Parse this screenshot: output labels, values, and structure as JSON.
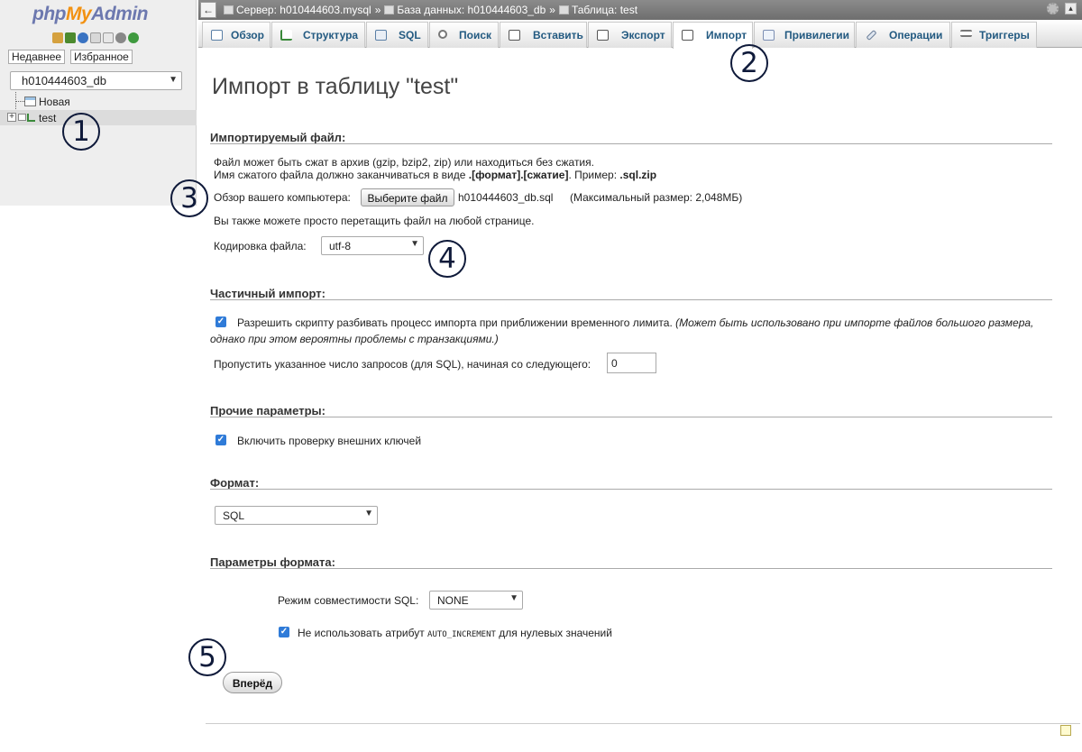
{
  "left_panel": {
    "logo": {
      "php": "php",
      "my": "My",
      "admin": "Admin"
    },
    "quick_icons": [
      "home-icon",
      "exit-icon",
      "help-icon",
      "docs-icon",
      "sql-docs-icon",
      "settings-icon",
      "reload-icon"
    ],
    "tabs": {
      "recent": "Недавнее",
      "favorites": "Избранное"
    },
    "db_select_value": "h010444603_db",
    "tree": {
      "new_label": "Новая",
      "table_label": "test"
    }
  },
  "topbar": {
    "breadcrumb": {
      "server": "Сервер: h010444603.mysql",
      "database": "База данных: h010444603_db",
      "table": "Таблица: test",
      "separator": "»"
    }
  },
  "tabs": [
    {
      "label": "Обзор",
      "icon": "browse-icon"
    },
    {
      "label": "Структура",
      "icon": "structure-icon"
    },
    {
      "label": "SQL",
      "icon": "sql-icon"
    },
    {
      "label": "Поиск",
      "icon": "search-icon"
    },
    {
      "label": "Вставить",
      "icon": "insert-icon"
    },
    {
      "label": "Экспорт",
      "icon": "export-icon"
    },
    {
      "label": "Импорт",
      "icon": "import-icon",
      "active": true
    },
    {
      "label": "Привилегии",
      "icon": "privileges-icon"
    },
    {
      "label": "Операции",
      "icon": "operations-icon"
    },
    {
      "label": "Триггеры",
      "icon": "triggers-icon"
    }
  ],
  "page": {
    "title": "Импорт в таблицу \"test\"",
    "file_section": {
      "heading": "Импортируемый файл:",
      "line1": "Файл может быть сжат в архив (gzip, bzip2, zip) или находиться без сжатия.",
      "line2_prefix": "Имя сжатого файла должно заканчиваться в виде ",
      "line2_format": ".[формат].[сжатие]",
      "line2_mid": ". Пример: ",
      "line2_example": ".sql.zip",
      "browse_label": "Обзор вашего компьютера:",
      "choose_button": "Выберите файл",
      "chosen_file": "h010444603_db.sql",
      "max_size": "(Максимальный размер: 2,048МБ)",
      "drag_hint": "Вы также можете просто перетащить файл на любой странице.",
      "charset_label": "Кодировка файла:",
      "charset_value": "utf-8"
    },
    "partial_section": {
      "heading": "Частичный импорт:",
      "allow_interrupt_label": "Разрешить скрипту разбивать процесс импорта при приближении временного лимита.",
      "allow_interrupt_note_1": "(Может быть использовано при импорте файлов большого размера,",
      "allow_interrupt_note_2": "однако при этом вероятны проблемы с транзакциями.)",
      "skip_label": "Пропустить указанное число запросов (для SQL), начиная со следующего:",
      "skip_value": "0"
    },
    "other_section": {
      "heading": "Прочие параметры:",
      "fk_checks_label": "Включить проверку внешних ключей"
    },
    "format_section": {
      "heading": "Формат:",
      "format_value": "SQL"
    },
    "format_options_section": {
      "heading": "Параметры формата:",
      "compat_label": "Режим совместимости SQL:",
      "compat_value": "NONE",
      "no_auto_inc_prefix": "Не использовать атрибут ",
      "no_auto_inc_code": "AUTO_INCREMENT",
      "no_auto_inc_suffix": " для нулевых значений"
    },
    "submit_button": "Вперёд"
  },
  "annotations": [
    "1",
    "2",
    "3",
    "4",
    "5"
  ],
  "colors": {
    "tab_text": "#235a81",
    "annotation": "#0f1a3a",
    "checkbox": "#2f7bd8",
    "logo_blue": "#6c78af",
    "logo_orange": "#f29111"
  }
}
